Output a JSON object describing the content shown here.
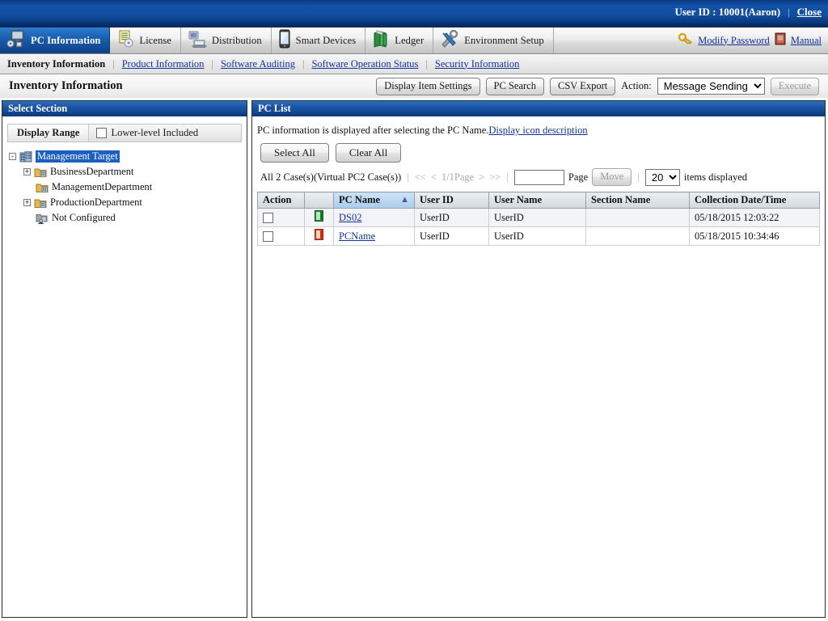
{
  "topbar": {
    "user_label": "User ID : 10001(Aaron)",
    "close_label": "Close",
    "separator": "|"
  },
  "tabs": [
    {
      "label": "PC Information",
      "icon": "pc-monitor-icon",
      "active": true
    },
    {
      "label": "License",
      "icon": "license-document-icon",
      "active": false
    },
    {
      "label": "Distribution",
      "icon": "distribution-laptop-icon",
      "active": false
    },
    {
      "label": "Smart Devices",
      "icon": "smartphone-icon",
      "active": false
    },
    {
      "label": "Ledger",
      "icon": "books-icon",
      "active": false
    },
    {
      "label": "Environment Setup",
      "icon": "tools-wrench-icon",
      "active": false
    }
  ],
  "tabstrip_right": {
    "modify_password": "Modify Password",
    "manual": "Manual"
  },
  "subnav": {
    "current": "Inventory Information",
    "links": [
      "Product Information",
      "Software Auditing",
      "Software Operation Status",
      "Security Information"
    ],
    "separator": "|"
  },
  "pagebar": {
    "title": "Inventory Information",
    "display_item_settings": "Display Item Settings",
    "pc_search": "PC Search",
    "csv_export": "CSV Export",
    "action_label": "Action:",
    "action_selected": "Message Sending",
    "action_options": [
      "Message Sending"
    ],
    "execute": "Execute"
  },
  "left_panel": {
    "title": "Select Section",
    "display_range_label": "Display Range",
    "lower_level_label": "Lower-level Included",
    "lower_level_checked": false,
    "tree": [
      {
        "label": "Management Target",
        "level": 1,
        "expander": "-",
        "icon": "building-icon",
        "selected": true
      },
      {
        "label": "BusinessDepartment",
        "level": 2,
        "expander": "+",
        "icon": "folder-section-icon",
        "selected": false
      },
      {
        "label": "ManagementDepartment",
        "level": 2,
        "expander": "",
        "icon": "folder-section-icon",
        "selected": false
      },
      {
        "label": "ProductionDepartment",
        "level": 2,
        "expander": "+",
        "icon": "folder-section-icon",
        "selected": false
      },
      {
        "label": "Not Configured",
        "level": 2,
        "expander": "",
        "icon": "folder-user-icon",
        "selected": false
      }
    ]
  },
  "right_panel": {
    "title": "PC List",
    "hint_text": "PC information is displayed after selecting the PC Name.",
    "hint_link": "Display icon description",
    "select_all": "Select All",
    "clear_all": "Clear All",
    "pager": {
      "count_text": "All 2 Case(s)(Virtual PC2 Case(s))",
      "first": "<<",
      "prev": "<",
      "page_indicator": "1/1Page",
      "next": ">",
      "last": ">>",
      "page_input_value": "",
      "page_label": "Page",
      "move_button": "Move",
      "items_selected": "20",
      "items_options": [
        "20"
      ],
      "items_suffix": "items displayed",
      "separator": "|"
    },
    "columns": [
      "Action",
      "",
      "PC Name",
      "User ID",
      "User Name",
      "Section Name",
      "Collection Date/Time"
    ],
    "sorted_column": "PC Name",
    "sort_direction": "asc",
    "rows": [
      {
        "checked": false,
        "icon": "pc-green-icon",
        "icon_color": "#1f8a34",
        "pc_name": "DS02",
        "user_id": "UserID",
        "user_name": "UserID",
        "section_name": "",
        "collection_datetime": "05/18/2015 12:03:22"
      },
      {
        "checked": false,
        "icon": "pc-red-icon",
        "icon_color": "#e03a12",
        "pc_name": "PCName",
        "user_id": "UserID",
        "user_name": "UserID",
        "section_name": "",
        "collection_datetime": "05/18/2015 10:34:46"
      }
    ]
  },
  "colors": {
    "header_blue": "#14529f",
    "link_blue": "#16339c",
    "select_blue": "#1b5fc0"
  }
}
